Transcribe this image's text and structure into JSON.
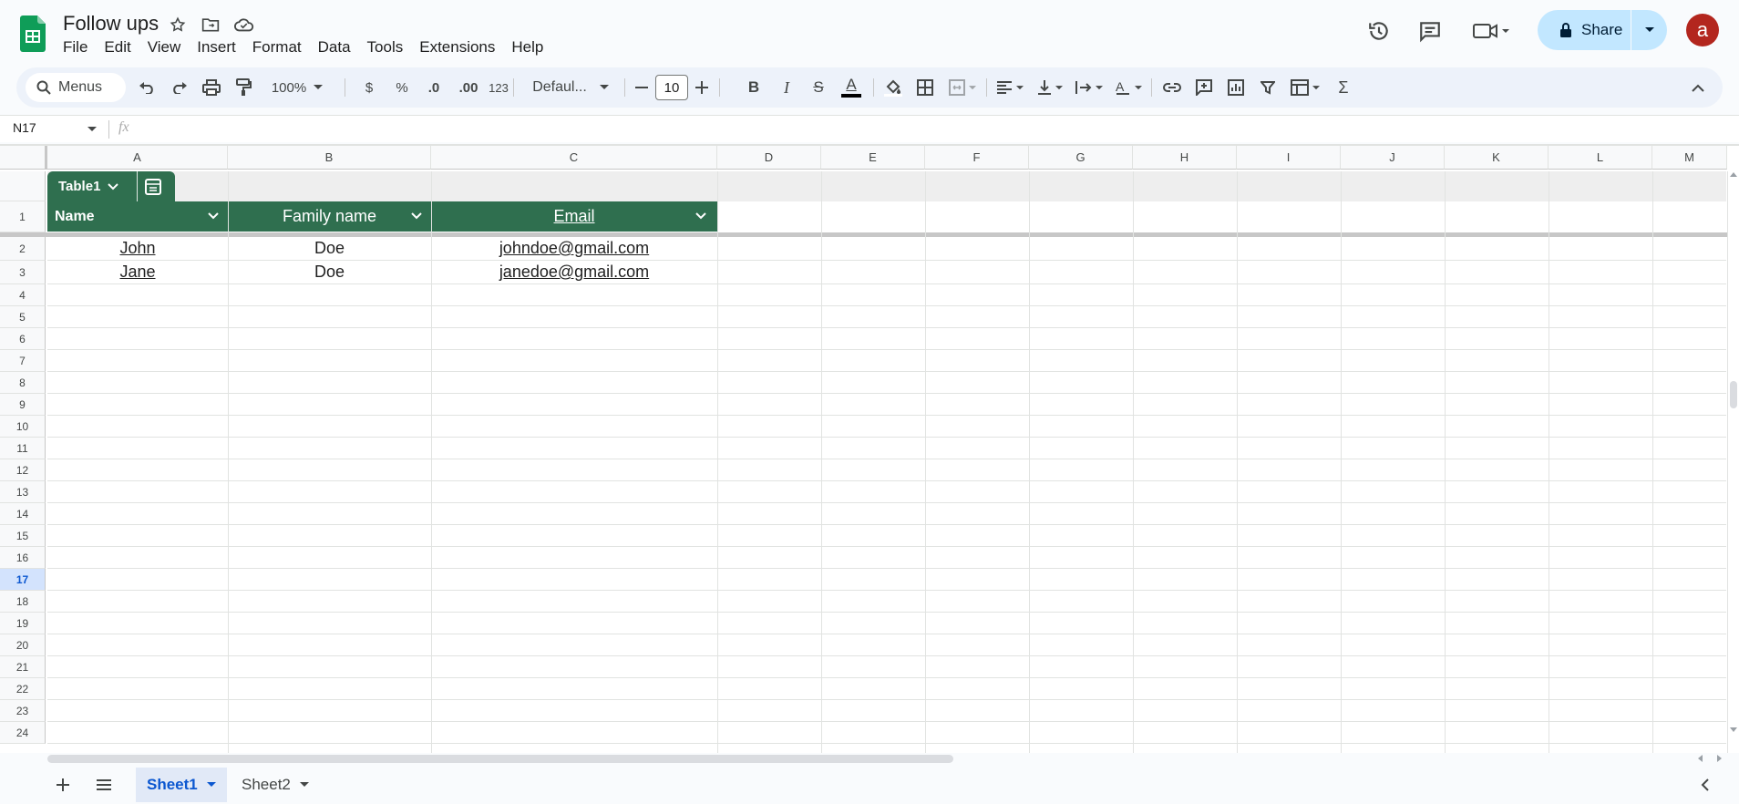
{
  "app": {
    "title": "Follow ups"
  },
  "menu": [
    "File",
    "Edit",
    "View",
    "Insert",
    "Format",
    "Data",
    "Tools",
    "Extensions",
    "Help"
  ],
  "header": {
    "share_label": "Share",
    "avatar_initial": "a"
  },
  "toolbar": {
    "search_label": "Menus",
    "zoom": "100%",
    "currency": "$",
    "percent": "%",
    "dec_decrease": ".0",
    "dec_increase": ".00",
    "format_more": "123",
    "font": "Defaul...",
    "font_size": "10"
  },
  "formula_bar": {
    "cell_ref": "N17",
    "fx": "fx",
    "value": ""
  },
  "columns": [
    "A",
    "B",
    "C",
    "D",
    "E",
    "F",
    "G",
    "H",
    "I",
    "J",
    "K",
    "L",
    "M"
  ],
  "rows": [
    "1",
    "2",
    "3",
    "4",
    "5",
    "6",
    "7",
    "8",
    "9",
    "10",
    "11",
    "12",
    "13",
    "14",
    "15",
    "16",
    "17",
    "18",
    "19",
    "20",
    "21",
    "22",
    "23",
    "24"
  ],
  "selected_row": "17",
  "table": {
    "name": "Table1",
    "headers": [
      "Name",
      "Family name",
      "Email"
    ],
    "rows": [
      [
        "John",
        "Doe",
        "johndoe@gmail.com"
      ],
      [
        "Jane",
        "Doe",
        "janedoe@gmail.com"
      ]
    ]
  },
  "sheets": {
    "tabs": [
      "Sheet1",
      "Sheet2"
    ],
    "active": "Sheet1"
  },
  "colors": {
    "table_green": "#2f6f4f",
    "share_bg": "#c2e7ff",
    "avatar_bg": "#b3261e",
    "active_tab": "#0b57d0"
  }
}
